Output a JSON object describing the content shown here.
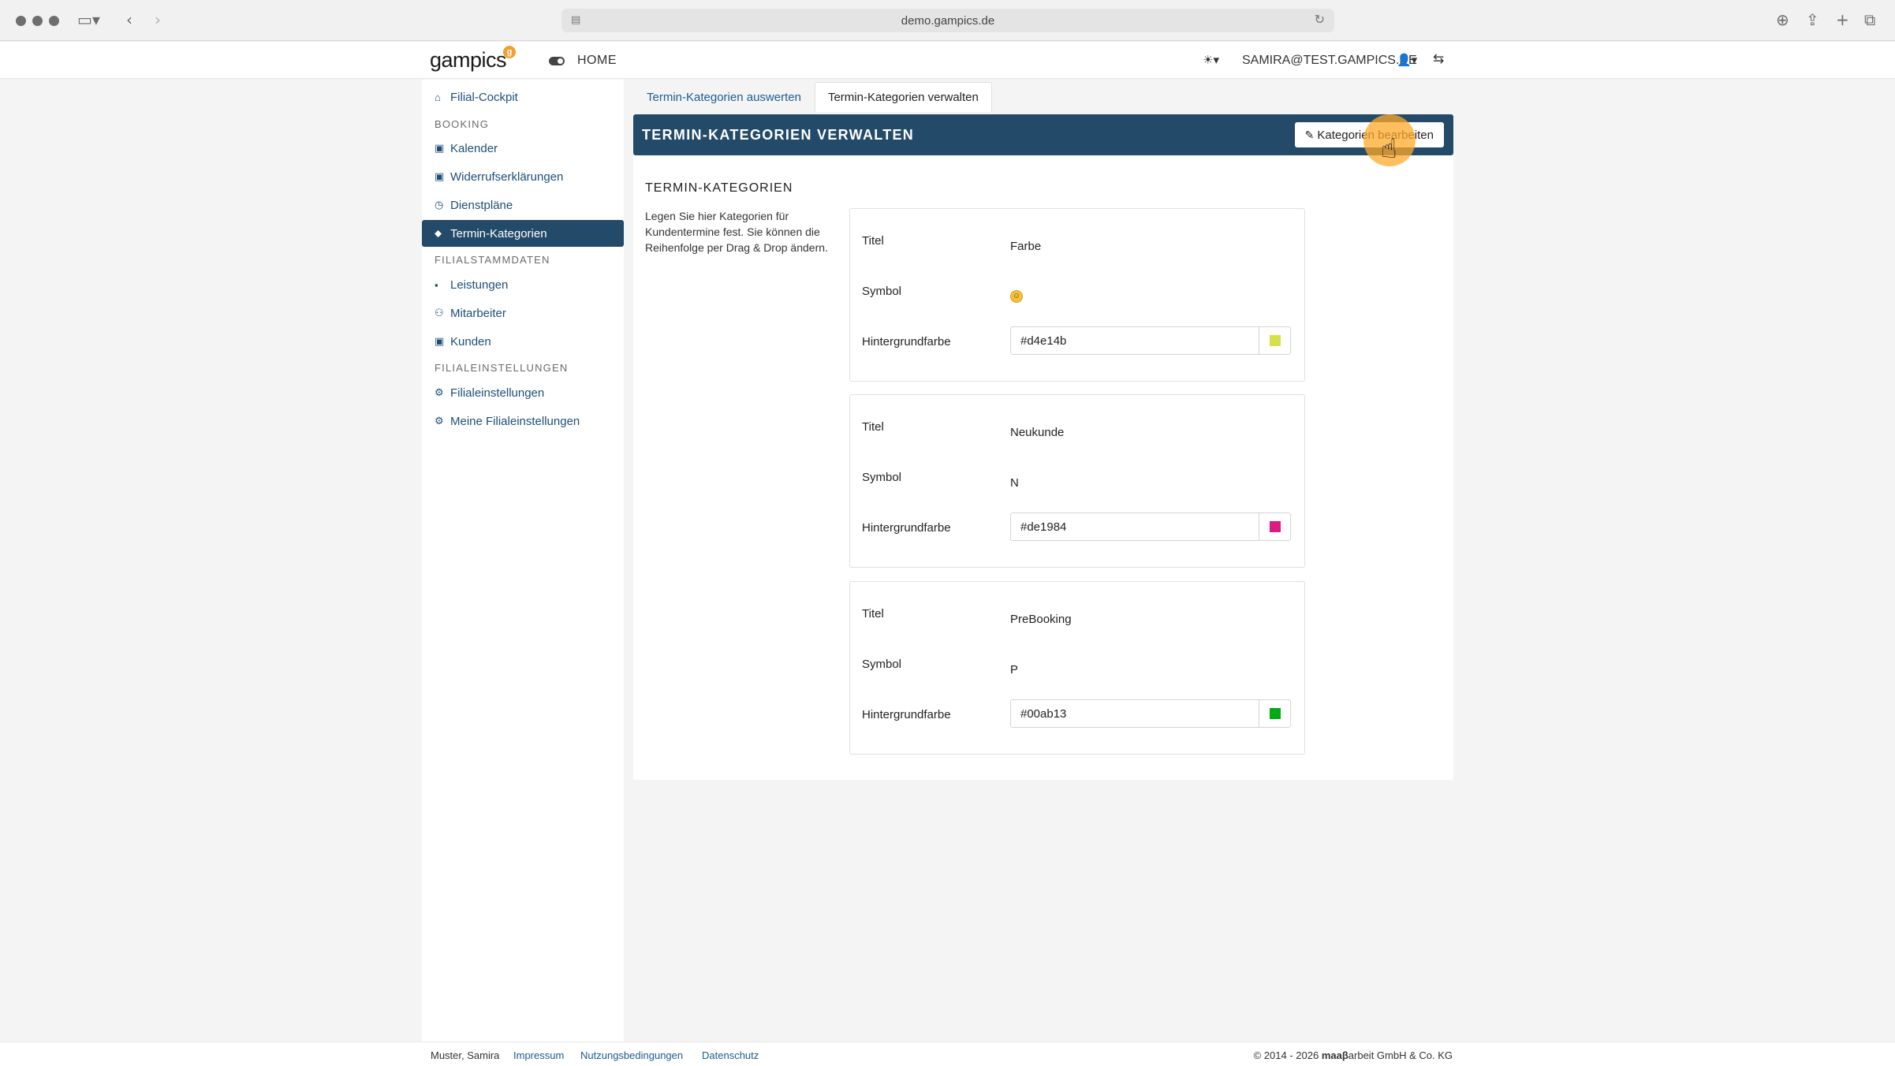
{
  "browser": {
    "url": "demo.gampics.de",
    "lock_icon": "page-icon",
    "reload_icon": "reload-icon"
  },
  "header": {
    "logo_text": "gampics",
    "logo_badge": "g",
    "home_label": "HOME",
    "theme_icon": "☀▾",
    "user_email": "SAMIRA@TEST.GAMPICS.DE",
    "user_icon": "👤▾",
    "switch_icon": "⇆"
  },
  "sidebar": {
    "items": [
      {
        "label": "Filial-Cockpit",
        "icon": "⌂"
      },
      {
        "label": "Kalender",
        "icon": "▣"
      },
      {
        "label": "Widerrufserklärungen",
        "icon": "▣"
      },
      {
        "label": "Dienstpläne",
        "icon": "◷"
      },
      {
        "label": "Termin-Kategorien",
        "icon": "⬥"
      },
      {
        "label": "Leistungen",
        "icon": "▪"
      },
      {
        "label": "Mitarbeiter",
        "icon": "⚇"
      },
      {
        "label": "Kunden",
        "icon": "▣"
      },
      {
        "label": "Filialeinstellungen",
        "icon": "⚙"
      },
      {
        "label": "Meine Filialeinstellungen",
        "icon": "⚙"
      }
    ],
    "sections": [
      "BOOKING",
      "FILIALSTAMMDATEN",
      "FILIALEINSTELLUNGEN"
    ],
    "active": "Termin-Kategorien",
    "active_color": "#234a68"
  },
  "tabs": [
    {
      "label": "Termin-Kategorien auswerten",
      "active": false
    },
    {
      "label": "Termin-Kategorien verwalten",
      "active": true
    }
  ],
  "panel": {
    "title": "TERMIN-KATEGORIEN VERWALTEN",
    "edit_button": "Kategorien bearbeiten",
    "edit_icon": "✎",
    "section_title": "TERMIN-KATEGORIEN",
    "section_desc": "Legen Sie hier Kategorien für Kundentermine fest. Sie können die Reihenfolge per Drag & Drop ändern.",
    "labels": {
      "title": "Titel",
      "symbol": "Symbol",
      "background": "Hintergrundfarbe"
    },
    "categories": [
      {
        "title": "Farbe",
        "symbol": "😊",
        "color": "#d4e14b"
      },
      {
        "title": "Neukunde",
        "symbol": "N",
        "color": "#de1984"
      },
      {
        "title": "PreBooking",
        "symbol": "P",
        "color": "#00ab13"
      }
    ]
  },
  "footer": {
    "name": "Muster, Samira",
    "links": [
      "Impressum",
      "Nutzungsbedingungen",
      "Datenschutz"
    ],
    "copyright_prefix": "© 2014 - 2026 ",
    "copyright_brand": "maaβ",
    "copyright_suffix": "arbeit GmbH & Co. KG"
  }
}
